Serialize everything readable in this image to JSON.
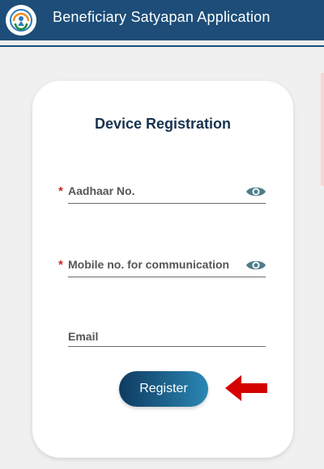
{
  "app": {
    "title": "Beneficiary Satyapan Application"
  },
  "icons": {
    "logo": "app-logo-icon",
    "eye": "eye-icon",
    "arrow": "arrow-left-icon"
  },
  "colors": {
    "app_bar": "#1d4d78",
    "accent_red": "#d50000",
    "title_text": "#18334d",
    "button_start": "#0f3b61",
    "button_end": "#2a87b4",
    "eye": "#4e7d88"
  },
  "form": {
    "title": "Device Registration",
    "fields": [
      {
        "label": "Aadhaar No.",
        "required_mark": "*",
        "value": ""
      },
      {
        "label": "Mobile no. for communication",
        "required_mark": "*",
        "value": ""
      },
      {
        "label": "Email",
        "required_mark": "",
        "value": ""
      }
    ],
    "register_label": "Register"
  }
}
